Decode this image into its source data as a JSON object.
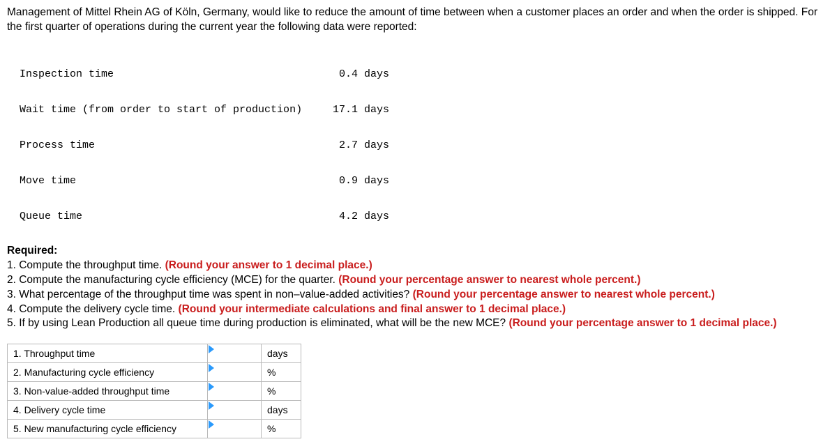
{
  "intro": "Management of Mittel Rhein AG of Köln, Germany, would like to reduce the amount of time between when a customer places an order and when the order is shipped. For the first quarter of operations during the current year the following data were reported:",
  "data_table": {
    "rows": [
      {
        "label": "Inspection time",
        "value": "0.4 days"
      },
      {
        "label": "Wait time (from order to start of production)",
        "value": "17.1 days"
      },
      {
        "label": "Process time",
        "value": "2.7 days"
      },
      {
        "label": "Move time",
        "value": "0.9 days"
      },
      {
        "label": "Queue time",
        "value": "4.2 days"
      }
    ]
  },
  "required_label": "Required:",
  "questions": {
    "q1_text": "1. Compute the throughput time. ",
    "q1_hint": "(Round your answer to 1 decimal place.)",
    "q2_text": "2. Compute the manufacturing cycle efficiency (MCE) for the quarter. ",
    "q2_hint": "(Round your percentage answer to nearest whole percent.)",
    "q3_text": "3. What percentage of the throughput time was spent in non–value-added activities? ",
    "q3_hint": "(Round your percentage answer to nearest whole percent.)",
    "q4_text": "4. Compute the delivery cycle time. ",
    "q4_hint": "(Round your intermediate calculations and final answer to 1 decimal place.)",
    "q5_text": "5. If by using Lean Production all queue time during production is eliminated, what will be the new MCE? ",
    "q5_hint": "(Round your percentage answer to 1 decimal place.)"
  },
  "answers_table": {
    "rows": [
      {
        "label": "1. Throughput time",
        "unit": "days"
      },
      {
        "label": "2. Manufacturing cycle efficiency",
        "unit": "%"
      },
      {
        "label": "3. Non-value-added throughput time",
        "unit": "%"
      },
      {
        "label": "4. Delivery cycle time",
        "unit": "days"
      },
      {
        "label": "5. New manufacturing cycle efficiency",
        "unit": "%"
      }
    ]
  }
}
